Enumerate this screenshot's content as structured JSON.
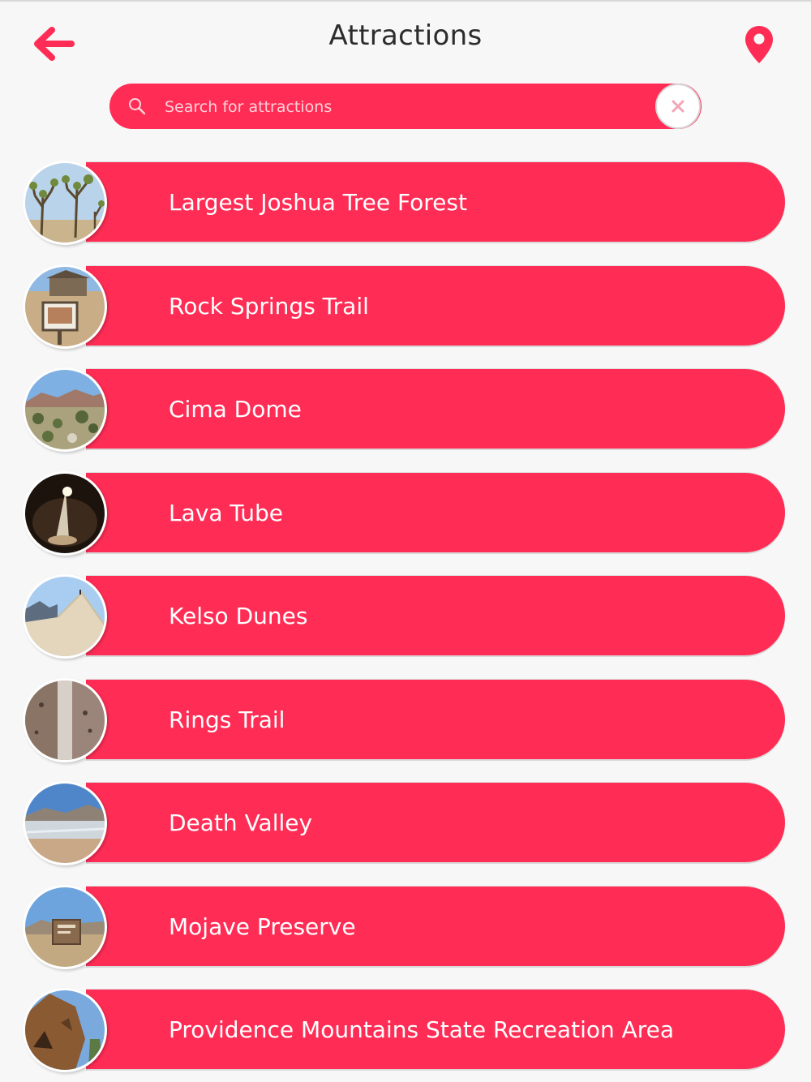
{
  "header": {
    "title": "Attractions",
    "back_icon": "arrow-left-icon",
    "map_icon": "map-pin-icon"
  },
  "search": {
    "placeholder": "Search for attractions",
    "value": "",
    "icon": "search-icon",
    "clear_icon": "close-icon"
  },
  "colors": {
    "accent": "#ff2d55",
    "background": "#f7f7f7",
    "title_text": "#2c2c2c"
  },
  "attractions": [
    {
      "label": "Largest Joshua Tree Forest",
      "image": "joshua-trees-photo"
    },
    {
      "label": "Rock Springs Trail",
      "image": "rock-springs-cabin-photo"
    },
    {
      "label": "Cima Dome",
      "image": "cima-dome-photo"
    },
    {
      "label": "Lava Tube",
      "image": "lava-tube-photo"
    },
    {
      "label": "Kelso Dunes",
      "image": "kelso-dunes-photo"
    },
    {
      "label": "Rings Trail",
      "image": "rings-trail-photo"
    },
    {
      "label": "Death Valley",
      "image": "death-valley-photo"
    },
    {
      "label": "Mojave Preserve",
      "image": "mojave-preserve-sign-photo"
    },
    {
      "label": "Providence Mountains State Recreation Area",
      "image": "providence-mountains-photo"
    }
  ]
}
